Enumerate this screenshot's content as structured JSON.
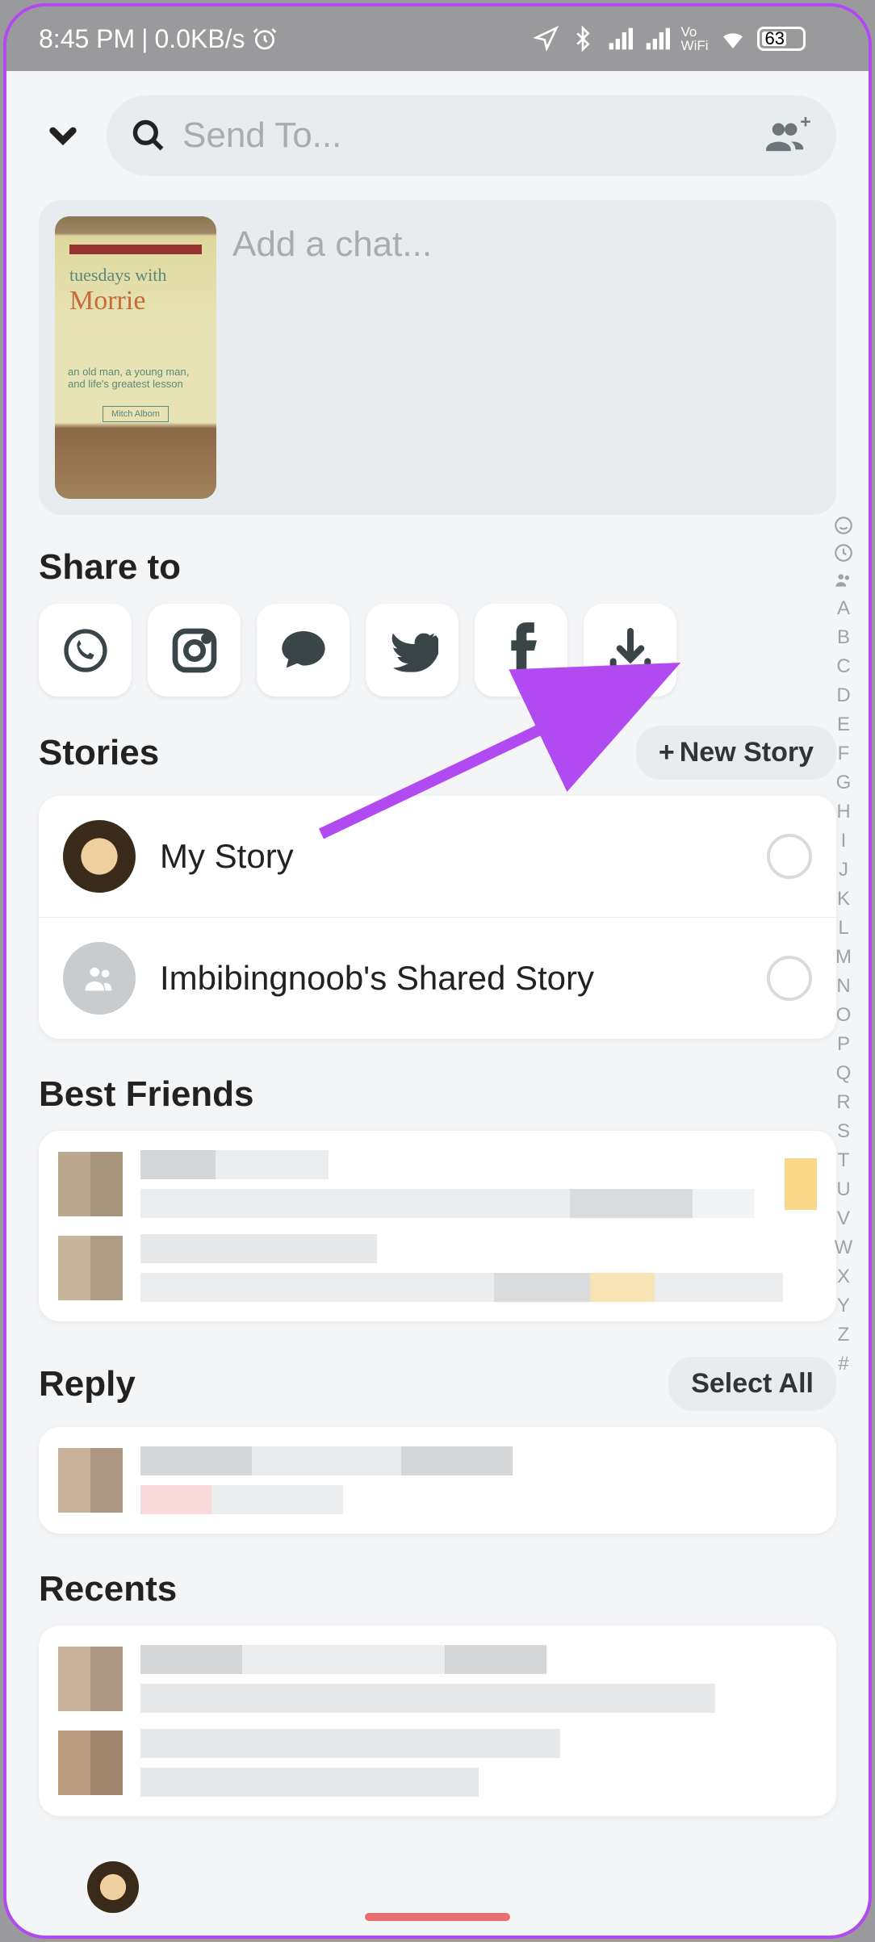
{
  "status": {
    "time": "8:45 PM",
    "net_speed": "0.0KB/s",
    "battery_pct": "63",
    "vowifi": "Vo\nWiFi"
  },
  "search": {
    "placeholder": "Send To..."
  },
  "chat": {
    "placeholder": "Add a chat..."
  },
  "book": {
    "line1": "tuesdays with",
    "line2": "Morrie",
    "subtitle": "an old man, a young man,\nand life's greatest lesson",
    "author": "Mitch Albom"
  },
  "sections": {
    "share_to": "Share to",
    "stories": "Stories",
    "best_friends": "Best Friends",
    "reply": "Reply",
    "recents": "Recents"
  },
  "buttons": {
    "new_story": "New Story",
    "select_all": "Select All"
  },
  "stories": [
    {
      "label": "My Story"
    },
    {
      "label": "Imbibingnoob's Shared Story"
    }
  ],
  "share_targets": [
    "whatsapp",
    "instagram",
    "chat",
    "twitter",
    "facebook",
    "download"
  ],
  "index_letters": [
    "A",
    "B",
    "C",
    "D",
    "E",
    "F",
    "G",
    "H",
    "I",
    "J",
    "K",
    "L",
    "M",
    "N",
    "O",
    "P",
    "Q",
    "R",
    "S",
    "T",
    "U",
    "V",
    "W",
    "X",
    "Y",
    "Z",
    "#"
  ]
}
